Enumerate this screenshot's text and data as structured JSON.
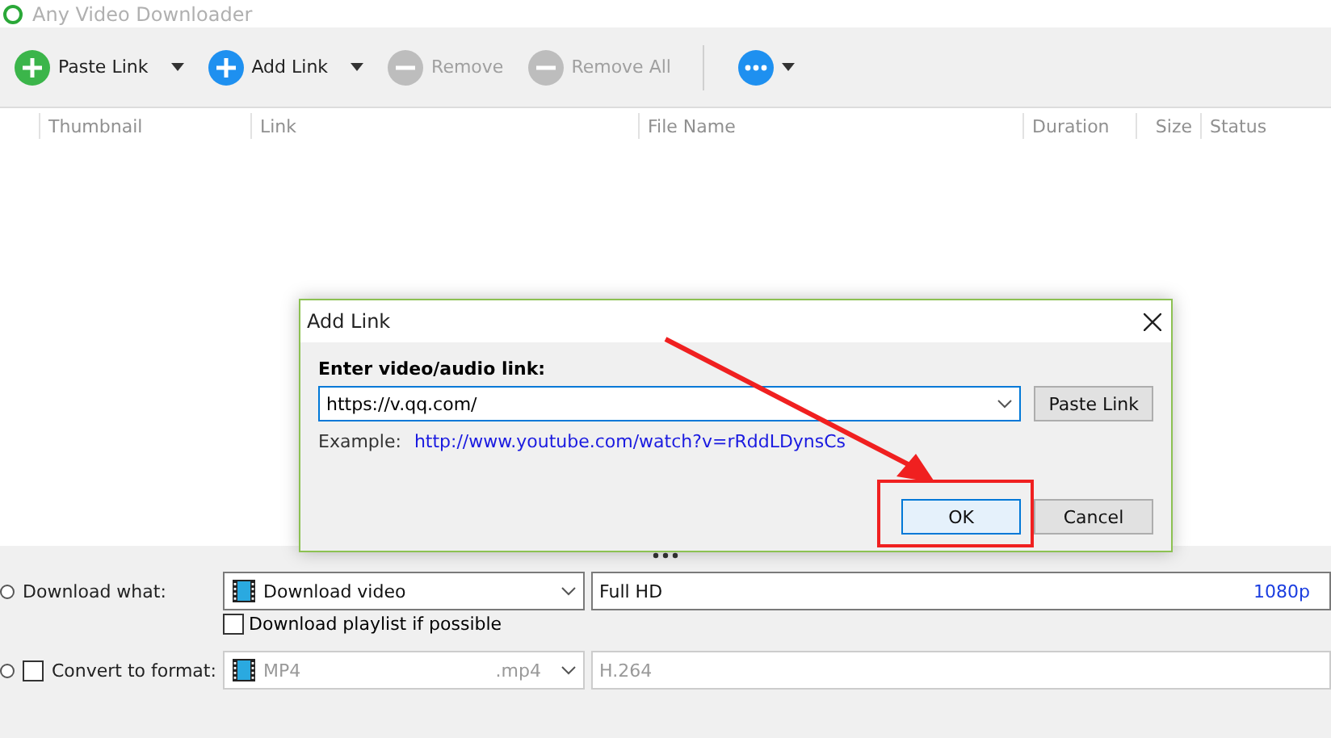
{
  "window": {
    "title": "Any Video Downloader"
  },
  "toolbar": {
    "buttons": [
      {
        "kind": "paste",
        "label": "Paste Link",
        "dropdown": true,
        "disabled": false
      },
      {
        "kind": "add",
        "label": "Add Link",
        "dropdown": true,
        "disabled": false
      },
      {
        "kind": "remove",
        "label": "Remove",
        "dropdown": false,
        "disabled": true
      },
      {
        "kind": "remove",
        "label": "Remove All",
        "dropdown": false,
        "disabled": true
      },
      {
        "kind": "more",
        "dropdown": true,
        "disabled": false
      }
    ]
  },
  "table": {
    "columns": [
      "Thumbnail",
      "Link",
      "File Name",
      "Duration",
      "Size",
      "Status"
    ]
  },
  "dialog": {
    "title": "Add Link",
    "prompt": "Enter video/audio link:",
    "link_value": "https://v.qq.com/",
    "paste_button": "Paste Link",
    "example_label": "Example:",
    "example_link": "http://www.youtube.com/watch?v=rRddLDynsCs",
    "buttons": [
      {
        "label": "OK",
        "focused": true
      },
      {
        "label": "Cancel",
        "focused": false
      }
    ]
  },
  "settings": {
    "download_what": {
      "selected": false,
      "label": "Download what:",
      "value": "Download video",
      "quality": "Full HD",
      "resolution": "1080p",
      "playlist": {
        "label": "Download playlist if possible",
        "checked": false
      }
    },
    "convert": {
      "selected": false,
      "label": "Convert to format:",
      "checked": false,
      "disabled": true,
      "format": "MP4",
      "extension": ".mp4",
      "codec": "H.264"
    }
  }
}
